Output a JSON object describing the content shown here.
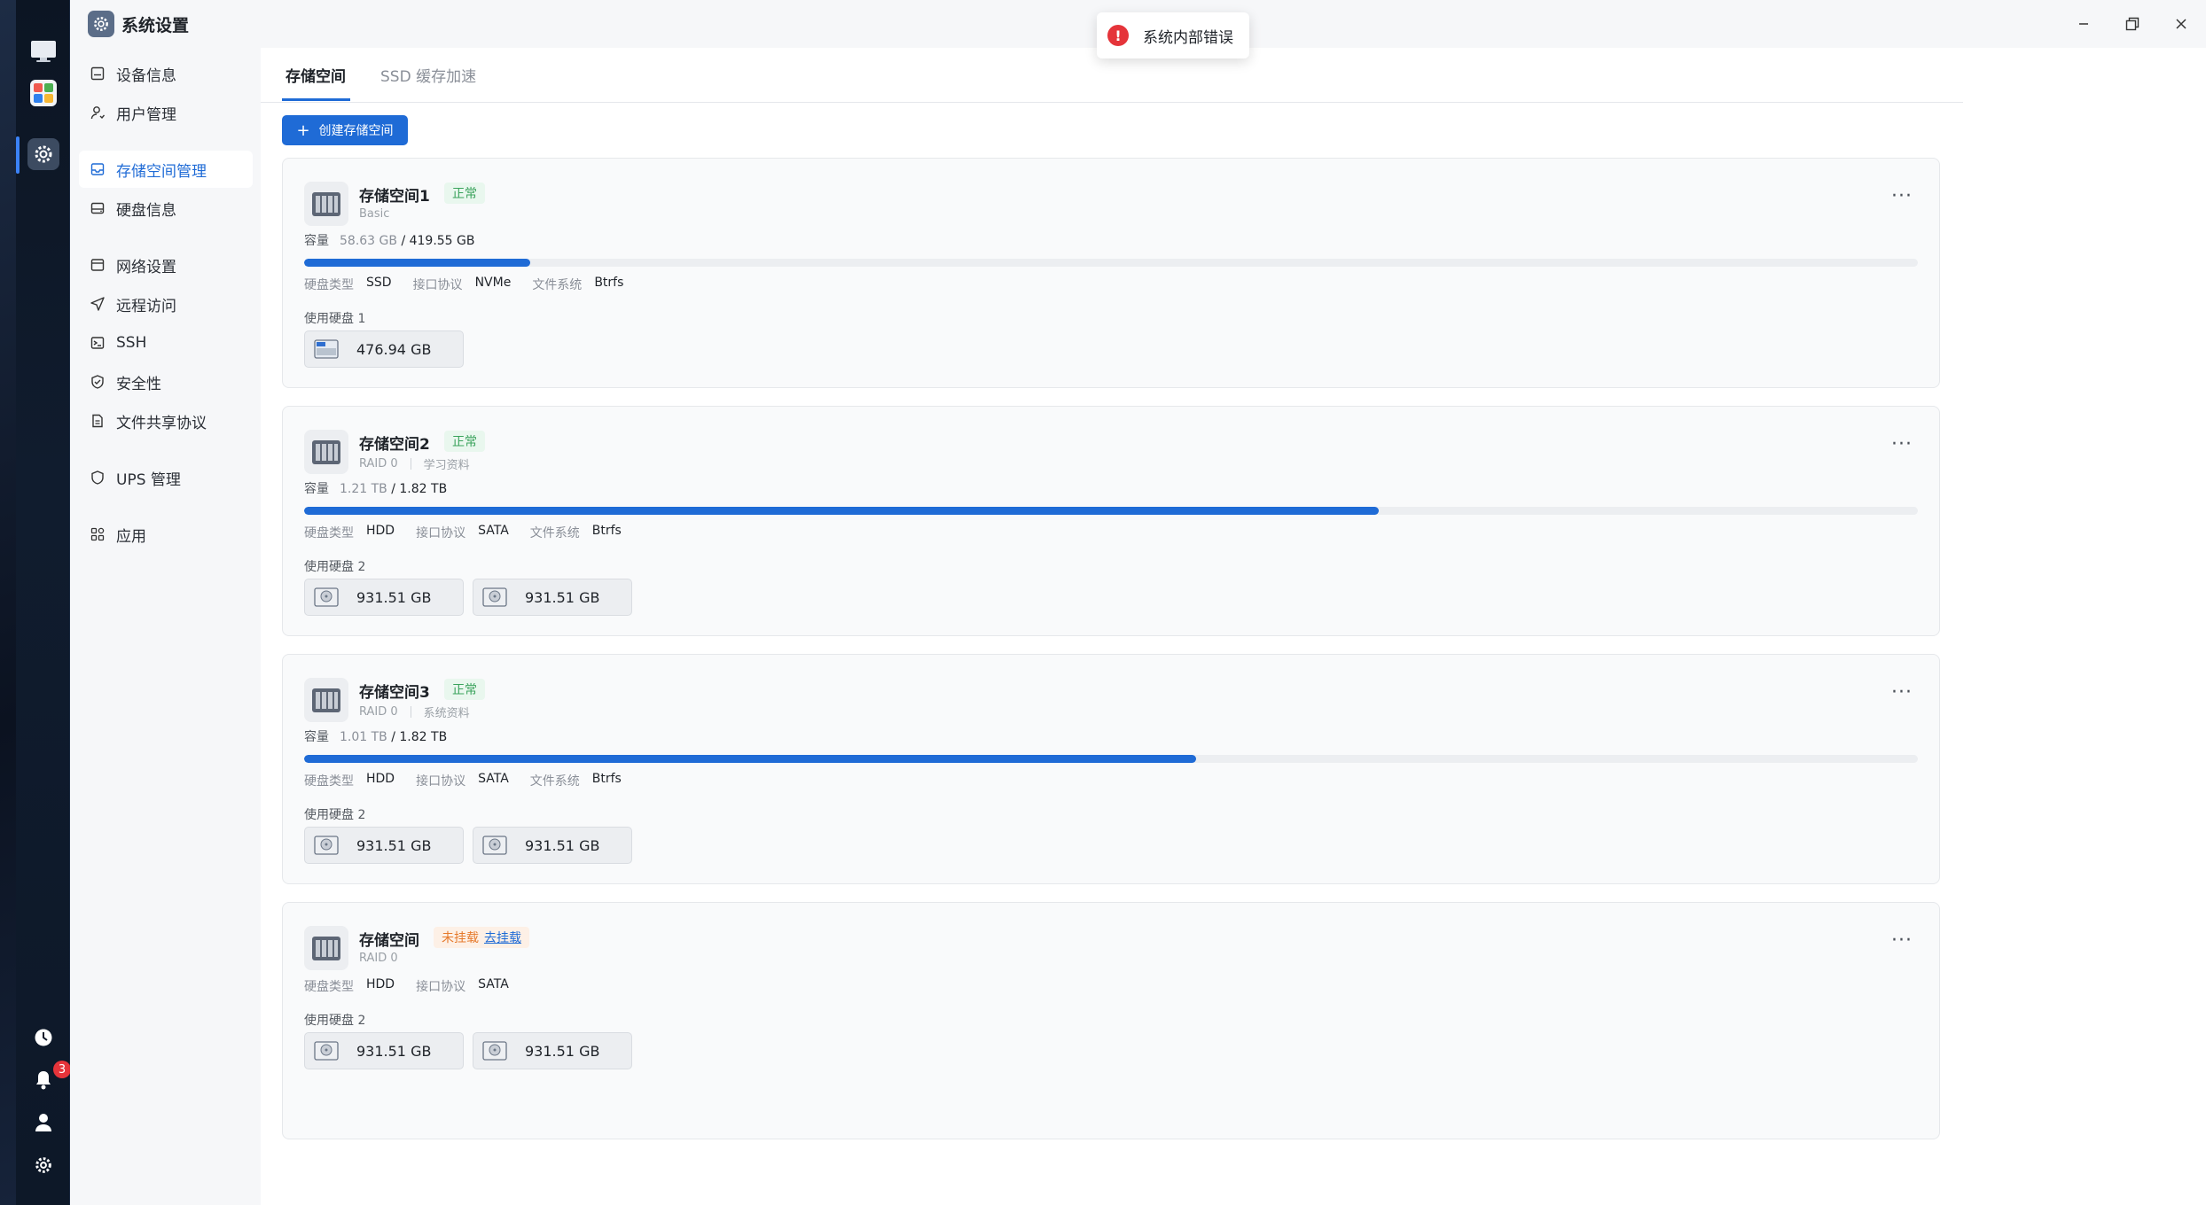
{
  "window": {
    "title": "系统设置"
  },
  "toast": {
    "message": "系统内部错误"
  },
  "dock": {
    "notification_count": "3"
  },
  "sidebar": {
    "items": [
      {
        "label": "设备信息",
        "icon": "monitor-icon"
      },
      {
        "label": "用户管理",
        "icon": "user-icon"
      },
      {
        "label": "存储空间管理",
        "icon": "storage-icon",
        "active": true
      },
      {
        "label": "硬盘信息",
        "icon": "disk-icon"
      },
      {
        "label": "网络设置",
        "icon": "network-icon"
      },
      {
        "label": "远程访问",
        "icon": "send-icon"
      },
      {
        "label": "SSH",
        "icon": "terminal-icon"
      },
      {
        "label": "安全性",
        "icon": "shield-check-icon"
      },
      {
        "label": "文件共享协议",
        "icon": "file-icon"
      },
      {
        "label": "UPS 管理",
        "icon": "shield-icon"
      },
      {
        "label": "应用",
        "icon": "apps-icon"
      }
    ]
  },
  "tabs": [
    {
      "label": "存储空间",
      "active": true
    },
    {
      "label": "SSD 缓存加速",
      "active": false
    }
  ],
  "create_button": {
    "label": "创建存储空间"
  },
  "labels": {
    "capacity": "容量",
    "disk_type": "硬盘类型",
    "interface": "接口协议",
    "filesystem": "文件系统",
    "more": "···"
  },
  "pools": [
    {
      "name": "存储空间1",
      "status": "正常",
      "status_kind": "ok",
      "raid": "Basic",
      "note": "",
      "used": "58.63 GB",
      "total": "/ 419.55 GB",
      "usage_fraction": 0.14,
      "disk_type": "SSD",
      "interface": "NVMe",
      "filesystem": "Btrfs",
      "disks_label": "使用硬盘 1",
      "disks": [
        {
          "size": "476.94 GB",
          "kind": "ssd"
        }
      ]
    },
    {
      "name": "存储空间2",
      "status": "正常",
      "status_kind": "ok",
      "raid": "RAID 0",
      "note": "学习资料",
      "used": "1.21 TB",
      "total": "/ 1.82 TB",
      "usage_fraction": 0.666,
      "disk_type": "HDD",
      "interface": "SATA",
      "filesystem": "Btrfs",
      "disks_label": "使用硬盘 2",
      "disks": [
        {
          "size": "931.51 GB",
          "kind": "hdd"
        },
        {
          "size": "931.51 GB",
          "kind": "hdd"
        }
      ]
    },
    {
      "name": "存储空间3",
      "status": "正常",
      "status_kind": "ok",
      "raid": "RAID 0",
      "note": "系统资料",
      "used": "1.01 TB",
      "total": "/ 1.82 TB",
      "usage_fraction": 0.553,
      "disk_type": "HDD",
      "interface": "SATA",
      "filesystem": "Btrfs",
      "disks_label": "使用硬盘 2",
      "disks": [
        {
          "size": "931.51 GB",
          "kind": "hdd"
        },
        {
          "size": "931.51 GB",
          "kind": "hdd"
        }
      ]
    },
    {
      "name": "存储空间",
      "status": "未挂载",
      "status_kind": "warn",
      "status_action": "去挂载",
      "raid": "RAID 0",
      "note": "",
      "disk_type": "HDD",
      "interface": "SATA",
      "disks_label": "使用硬盘 2",
      "disks": [
        {
          "size": "931.51 GB",
          "kind": "hdd"
        },
        {
          "size": "931.51 GB",
          "kind": "hdd"
        }
      ]
    }
  ],
  "colors": {
    "accent": "#1f6bd6",
    "ok": "#3aa35c",
    "warn": "#e67a2c",
    "error": "#e5343a"
  }
}
